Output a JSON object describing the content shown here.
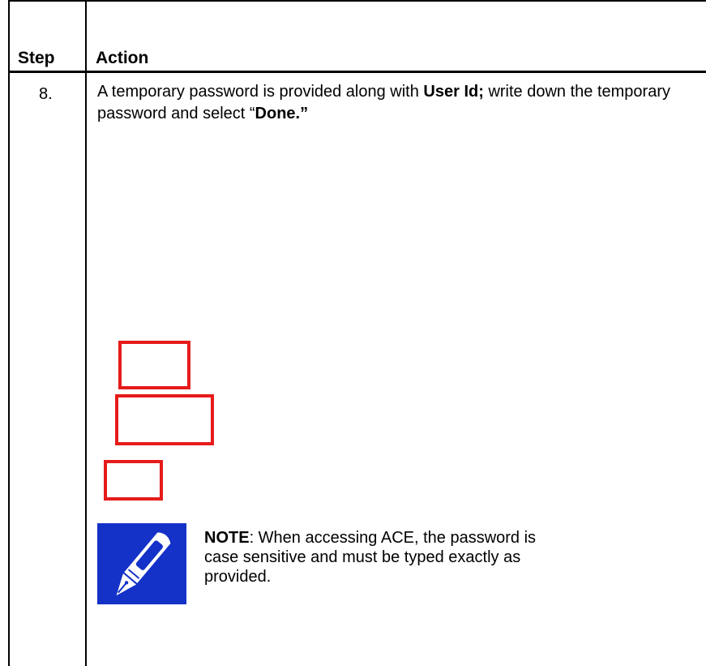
{
  "table": {
    "header_step": "Step",
    "header_action": "Action"
  },
  "row": {
    "step": "8.",
    "instruction": {
      "part1": "A temporary password is provided along with ",
      "bold1": "User Id;",
      "part2": " write down the temporary password and select “",
      "bold2": "Done.”"
    }
  },
  "highlights": {
    "color": "#e61b1b",
    "count": 3
  },
  "note": {
    "icon": "pen-icon",
    "icon_bg": "#1432c8",
    "label": "NOTE",
    "text": ": When accessing ACE, the password is case sensitive and must be typed exactly as provided."
  }
}
